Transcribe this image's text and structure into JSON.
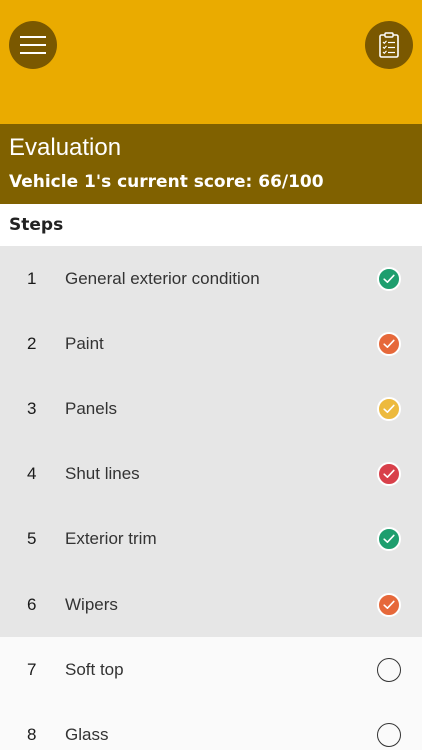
{
  "header": {
    "menu_icon": "hamburger-menu-icon",
    "clipboard_icon": "clipboard-checklist-icon",
    "bg_color": "#EAAB00",
    "button_color": "#7A5800"
  },
  "evaluation": {
    "title": "Evaluation",
    "score_text": "Vehicle 1's current score: 66/100",
    "bg_color": "#806100"
  },
  "steps": {
    "title": "Steps",
    "items": [
      {
        "number": "1",
        "label": "General exterior condition",
        "status": "complete",
        "color": "#1E9E6E"
      },
      {
        "number": "2",
        "label": "Paint",
        "status": "complete",
        "color": "#E6683A"
      },
      {
        "number": "3",
        "label": "Panels",
        "status": "complete",
        "color": "#EDBA3E"
      },
      {
        "number": "4",
        "label": "Shut lines",
        "status": "complete",
        "color": "#D8404A"
      },
      {
        "number": "5",
        "label": "Exterior trim",
        "status": "complete",
        "color": "#1E9E6E"
      },
      {
        "number": "6",
        "label": "Wipers",
        "status": "complete",
        "color": "#E6683A"
      },
      {
        "number": "7",
        "label": "Soft top",
        "status": "pending",
        "color": ""
      },
      {
        "number": "8",
        "label": "Glass",
        "status": "pending",
        "color": ""
      }
    ]
  }
}
